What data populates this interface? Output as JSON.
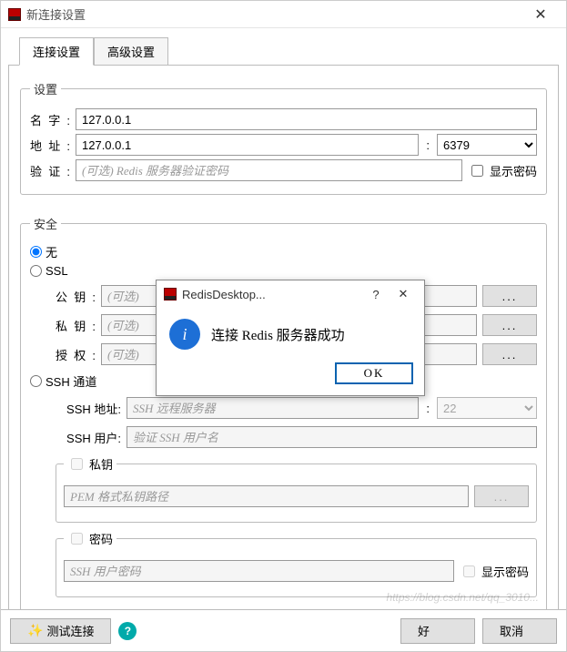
{
  "window": {
    "title": "新连接设置"
  },
  "tabs": {
    "connection": "连接设置",
    "advanced": "高级设置"
  },
  "settings": {
    "legend": "设置",
    "name_label": "名字:",
    "name_value": "127.0.0.1",
    "addr_label": "地址:",
    "addr_value": "127.0.0.1",
    "colon": ":",
    "port_value": "6379",
    "auth_label": "验证:",
    "auth_placeholder": "(可选) Redis 服务器验证密码",
    "show_password": "显示密码"
  },
  "security": {
    "legend": "安全",
    "opt_none": "无",
    "opt_ssl": "SSL",
    "ssl_pubkey_label": "公钥:",
    "ssl_pubkey_placeholder": "(可选)",
    "ssl_privkey_label": "私钥:",
    "ssl_privkey_placeholder": "(可选)",
    "ssl_auth_label": "授权:",
    "ssl_auth_placeholder": "(可选)",
    "browse": "...",
    "opt_ssh": "SSH 通道",
    "ssh_host_label": "SSH 地址:",
    "ssh_host_placeholder": "SSH 远程服务器",
    "ssh_port": "22",
    "ssh_user_label": "SSH 用户:",
    "ssh_user_placeholder": "验证 SSH 用户名",
    "privkey_legend": "私钥",
    "privkey_placeholder": "PEM 格式私钥路径",
    "pass_legend": "密码",
    "pass_placeholder": "SSH 用户密码",
    "pass_show": "显示密码"
  },
  "footer": {
    "test": "测试连接",
    "ok": "好",
    "cancel": "取消",
    "help": "?"
  },
  "modal": {
    "title": "RedisDesktop...",
    "msg": "连接 Redis 服务器成功",
    "ok": "OK",
    "info_glyph": "i"
  },
  "watermark": "https://blog.csdn.net/qq_3010..."
}
